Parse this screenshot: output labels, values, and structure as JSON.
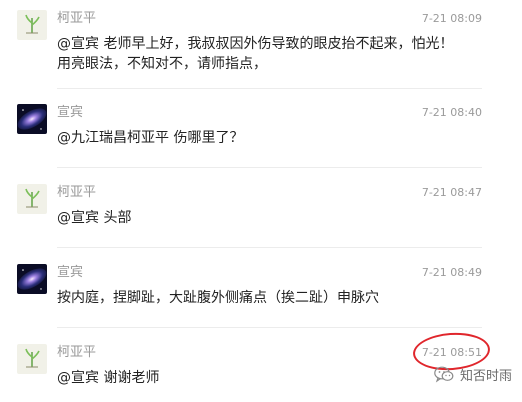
{
  "comments": [
    {
      "user": "柯亚平",
      "time": "7-21 08:09",
      "avatar": "bamboo-avatar",
      "lines": [
        "@宣宾 老师早上好，我叔叔因外伤导致的眼皮抬不起来，怕光！",
        "用亮眼法，不知对不，请师指点，"
      ]
    },
    {
      "user": "宣宾",
      "time": "7-21 08:40",
      "avatar": "galaxy-avatar",
      "lines": [
        "@九江瑞昌柯亚平 伤哪里了？"
      ]
    },
    {
      "user": "柯亚平",
      "time": "7-21 08:47",
      "avatar": "bamboo-avatar",
      "lines": [
        "@宣宾 头部"
      ]
    },
    {
      "user": "宣宾",
      "time": "7-21 08:49",
      "avatar": "galaxy-avatar",
      "lines": [
        "按内庭，捏脚趾，大趾腹外侧痛点（挨二趾）申脉穴"
      ]
    },
    {
      "user": "柯亚平",
      "time": "7-21 08:51",
      "avatar": "bamboo-avatar",
      "lines": [
        "@宣宾 谢谢老师"
      ]
    }
  ],
  "watermark": {
    "text": "知否时雨",
    "icon": "wechat-icon"
  },
  "colors": {
    "meta_text": "#9a9a9a",
    "body_text": "#222222",
    "highlight": "#e0262c"
  }
}
